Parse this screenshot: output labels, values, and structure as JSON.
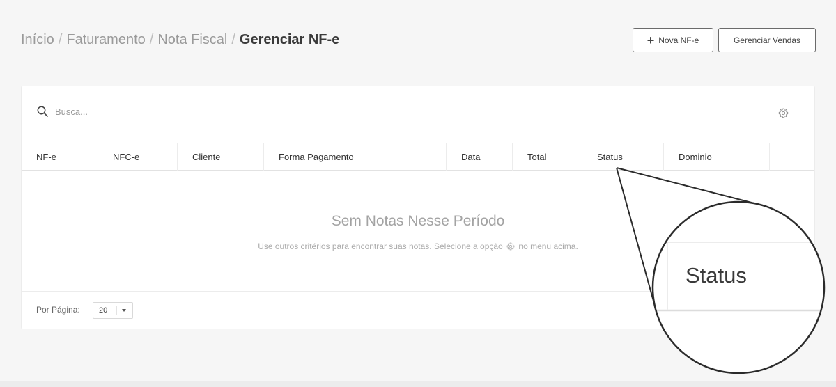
{
  "breadcrumb": {
    "items": [
      "Início",
      "Faturamento",
      "Nota Fiscal"
    ],
    "separator": "/",
    "current": "Gerenciar NF-e"
  },
  "actions": {
    "new_label": "Nova NF-e",
    "new_icon": "plus-icon",
    "sales_label": "Gerenciar Vendas"
  },
  "search": {
    "placeholder": "Busca...",
    "value": "",
    "icon": "search-icon",
    "settings_icon": "gear-icon"
  },
  "table": {
    "columns": [
      "NF-e",
      "NFC-e",
      "Cliente",
      "Forma Pagamento",
      "Data",
      "Total",
      "Status",
      "Dominio",
      ""
    ],
    "rows": []
  },
  "empty_state": {
    "title": "Sem Notas Nesse Período",
    "subtitle_before": "Use outros critérios para encontrar suas notas. Selecione a opção",
    "subtitle_after": "no menu acima."
  },
  "pagination": {
    "label": "Por Página:",
    "value": "20"
  },
  "zoom_callout": {
    "text": "Status"
  },
  "colors": {
    "background": "#f6f6f6",
    "card": "#ffffff",
    "border": "#ececec",
    "muted_text": "#9a9a9a"
  }
}
